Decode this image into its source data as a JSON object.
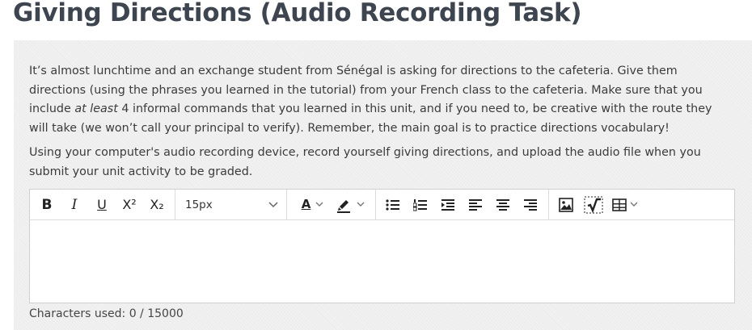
{
  "page": {
    "title": "Giving Directions (Audio Recording Task)"
  },
  "instructions": {
    "p1_part1": "It’s almost lunchtime and an exchange student from Sénégal is asking for directions to the cafeteria. Give them directions (using the phrases you learned in the tutorial) from your French class to the cafeteria. Make sure that you include ",
    "p1_emphasis": "at least",
    "p1_part2": " 4 informal commands that you learned in this unit, and if you need to, be creative with the route they will take (we won’t call your principal to verify). Remember, the main goal is to practice directions vocabulary!",
    "p2": "Using your computer's audio recording device, record yourself giving directions, and upload the audio file when you submit your unit activity to be graded."
  },
  "toolbar": {
    "bold": "B",
    "italic": "I",
    "underline": "U",
    "superscript": "X²",
    "subscript": "X₂",
    "font_size": "15px",
    "text_color_letter": "A",
    "icons": [
      "bold-icon",
      "italic-icon",
      "underline-icon",
      "superscript-icon",
      "subscript-icon",
      "chevron-down-icon",
      "font-color-icon",
      "highlighter-icon",
      "bulleted-list-icon",
      "numbered-list-icon",
      "indent-icon",
      "align-left-icon",
      "align-center-icon",
      "align-right-icon",
      "image-icon",
      "math-equation-icon",
      "table-icon"
    ],
    "colors": {
      "font_color_bar": "#222222",
      "highlight_bar": "#222222"
    }
  },
  "editor": {
    "content": ""
  },
  "footer": {
    "char_count": "Characters used: 0 / 15000"
  },
  "colors": {
    "title": "#3d4550",
    "panel_bg": "#f1f1f1",
    "text": "#3b3b3b"
  }
}
